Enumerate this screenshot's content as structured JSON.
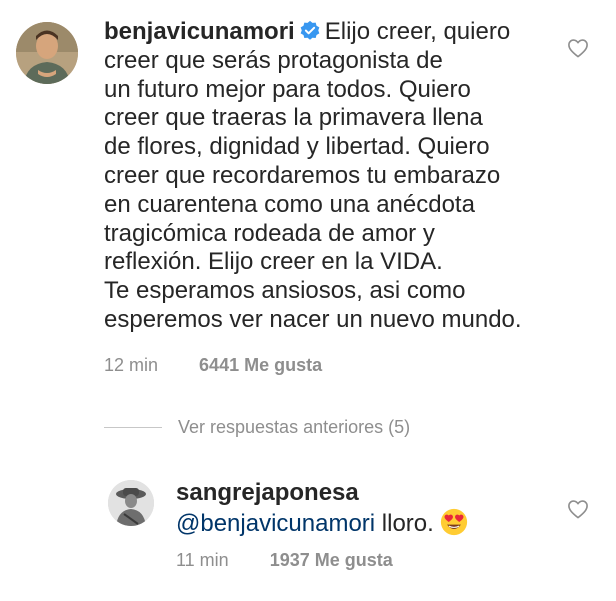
{
  "main_comment": {
    "username": "benjavicunamori",
    "text": "Elijo creer, quiero\ncreer que serás protagonista de\nun futuro mejor para todos. Quiero\ncreer que traeras la primavera llena\nde flores, dignidad y libertad. Quiero\ncreer que recordaremos tu embarazo\nen cuarentena como una anécdota\ntragicómica rodeada de amor y\nreflexión. Elijo creer en la VIDA.\nTe esperamos ansiosos, asi como\nesperemos ver nacer un nuevo mundo.",
    "time": "12 min",
    "likes": "6441 Me gusta",
    "verified_color": "#3897f0"
  },
  "replies_toggle": {
    "label": "Ver respuestas anteriores (5)"
  },
  "reply_comment": {
    "username": "sangrejaponesa",
    "mention": "@benjavicunamori",
    "text": "lloro.",
    "time": "11 min",
    "likes": "1937 Me gusta",
    "mention_color": "#003569"
  },
  "icons": {
    "like": "heart-outline-icon",
    "verified": "verified-badge-icon",
    "emoji": "heart-eyes-emoji-icon"
  },
  "colors": {
    "text": "#262626",
    "secondary": "#8e8e8e",
    "divider": "#c7c7c7"
  }
}
